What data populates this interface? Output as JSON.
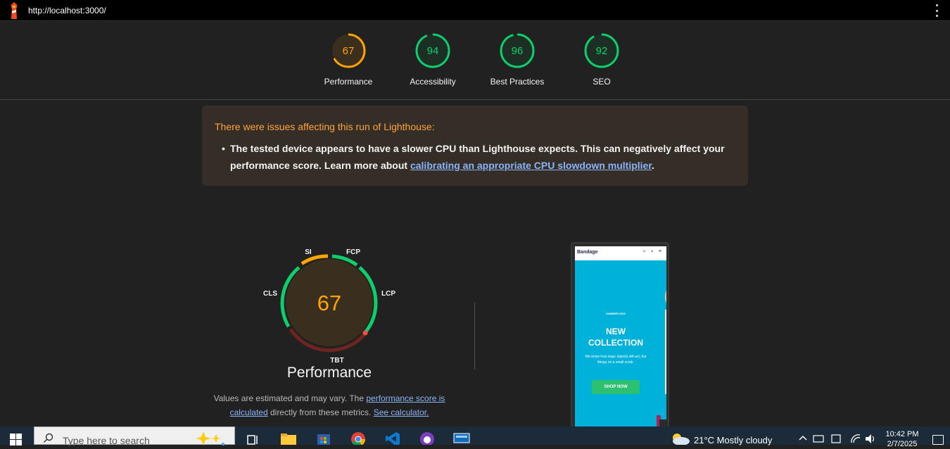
{
  "browser": {
    "url": "http://localhost:3000/"
  },
  "scores": [
    {
      "label": "Performance",
      "score": "67",
      "value": 0.67,
      "color": "#ffa400"
    },
    {
      "label": "Accessibility",
      "score": "94",
      "value": 0.94,
      "color": "#0cce6b"
    },
    {
      "label": "Best Practices",
      "score": "96",
      "value": 0.96,
      "color": "#0cce6b"
    },
    {
      "label": "SEO",
      "score": "92",
      "value": 0.92,
      "color": "#0cce6b"
    }
  ],
  "warning": {
    "title": "There were issues affecting this run of Lighthouse:",
    "message": "The tested device appears to have a slower CPU than Lighthouse expects. This can negatively affect your performance score. Learn more about ",
    "link_text": "calibrating an appropriate CPU slowdown multiplier",
    "suffix": "."
  },
  "performance": {
    "score": "67",
    "title": "Performance",
    "metrics": {
      "si": "SI",
      "fcp": "FCP",
      "lcp": "LCP",
      "tbt": "TBT",
      "cls": "CLS"
    },
    "note_pre": "Values are estimated and may vary. The ",
    "note_link1": "performance score is calculated",
    "note_mid": " directly from these metrics. ",
    "note_link2": "See calculator."
  },
  "screenshot": {
    "brand": "Bandage",
    "kicker": "SUMMER 2020",
    "headline_1": "NEW",
    "headline_2": "COLLECTION",
    "sub": "We know how large objects will act, but things on a small scale.",
    "cta": "SHOP NOW"
  },
  "taskbar": {
    "search_placeholder": "Type here to search",
    "weather": "21°C  Mostly cloudy",
    "time": "10:42 PM",
    "date": "2/7/2025"
  },
  "colors": {
    "pass": "#0cce6b",
    "average": "#ffa400",
    "fail": "#ff4e42",
    "link": "#8ab4f8"
  }
}
